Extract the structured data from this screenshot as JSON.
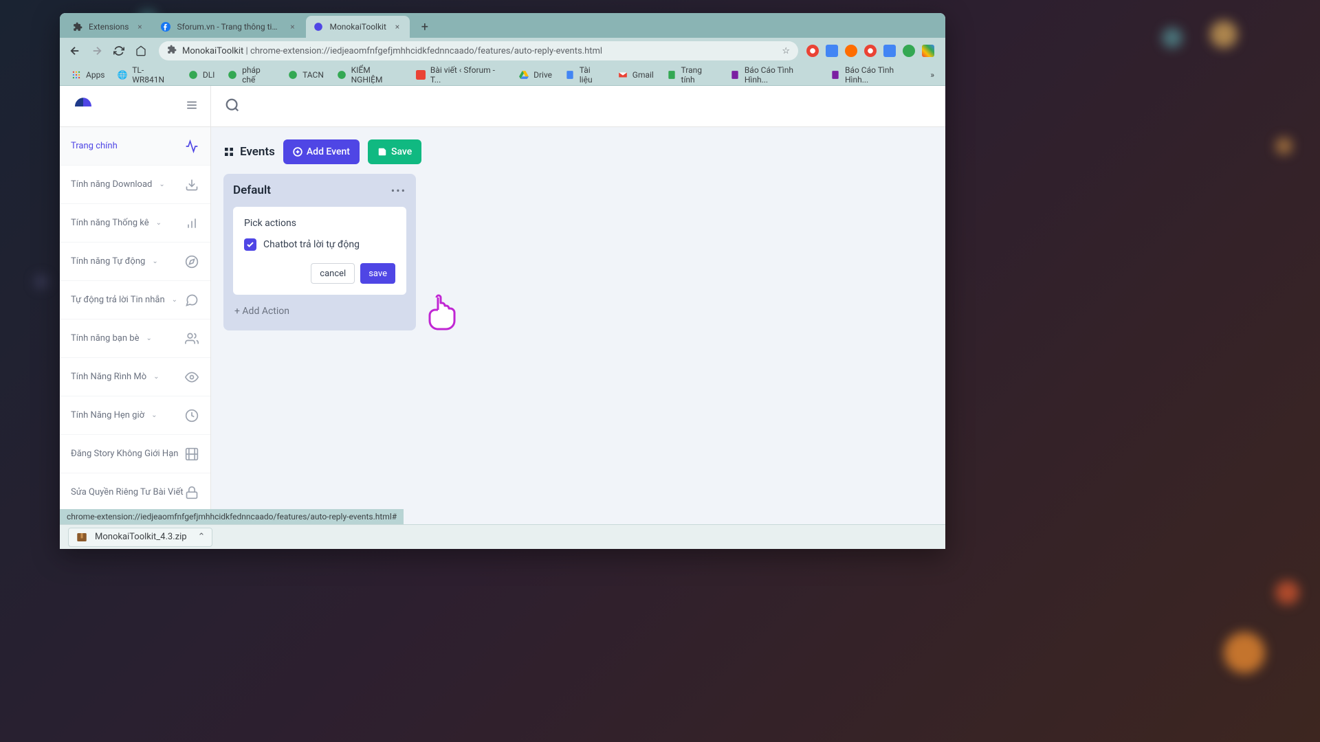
{
  "tabs": [
    {
      "title": "Extensions",
      "active": false
    },
    {
      "title": "Sforum.vn - Trang thông tin công",
      "active": false
    },
    {
      "title": "MonokaiToolkit",
      "active": true
    }
  ],
  "address": {
    "host": "MonokaiToolkit",
    "sep": " | ",
    "path": "chrome-extension://iedjeaomfnfgefjmhhcidkfednncaado/features/auto-reply-events.html"
  },
  "bookmarks": [
    {
      "label": "Apps"
    },
    {
      "label": "TL-WR841N"
    },
    {
      "label": "DLI"
    },
    {
      "label": "pháp chế"
    },
    {
      "label": "TACN"
    },
    {
      "label": "KIỂM NGHIỆM"
    },
    {
      "label": "Bài viết ‹ Sforum - T..."
    },
    {
      "label": "Drive"
    },
    {
      "label": "Tài liệu"
    },
    {
      "label": "Gmail"
    },
    {
      "label": "Trang tính"
    },
    {
      "label": "Báo Cáo Tình Hình..."
    },
    {
      "label": "Báo Cáo Tình Hình..."
    }
  ],
  "sidebar": [
    {
      "label": "Trang chính",
      "active": true,
      "expandable": false
    },
    {
      "label": "Tính năng Download",
      "active": false,
      "expandable": true
    },
    {
      "label": "Tính năng Thống kê",
      "active": false,
      "expandable": true
    },
    {
      "label": "Tính năng Tự động",
      "active": false,
      "expandable": true
    },
    {
      "label": "Tự động trả lời Tin nhắn",
      "active": false,
      "expandable": true
    },
    {
      "label": "Tính năng bạn bè",
      "active": false,
      "expandable": true
    },
    {
      "label": "Tính Năng Rình Mò",
      "active": false,
      "expandable": true
    },
    {
      "label": "Tính Năng Hẹn giờ",
      "active": false,
      "expandable": true
    },
    {
      "label": "Đăng Story Không Giới Hạn",
      "active": false,
      "expandable": false
    },
    {
      "label": "Sửa Quyền Riêng Tư Bài Viết",
      "active": false,
      "expandable": false
    }
  ],
  "events": {
    "title": "Events",
    "add_event": "Add Event",
    "save": "Save"
  },
  "card": {
    "title": "Default",
    "pick_actions": "Pick actions",
    "action_label": "Chatbot trả lời tự động",
    "cancel": "cancel",
    "save": "save",
    "add_action": "+  Add Action"
  },
  "status_text": "chrome-extension://iedjeaomfnfgefjmhhcidkfednncaado/features/auto-reply-events.html#",
  "download": {
    "filename": "MonokaiToolkit_4.3.zip"
  }
}
